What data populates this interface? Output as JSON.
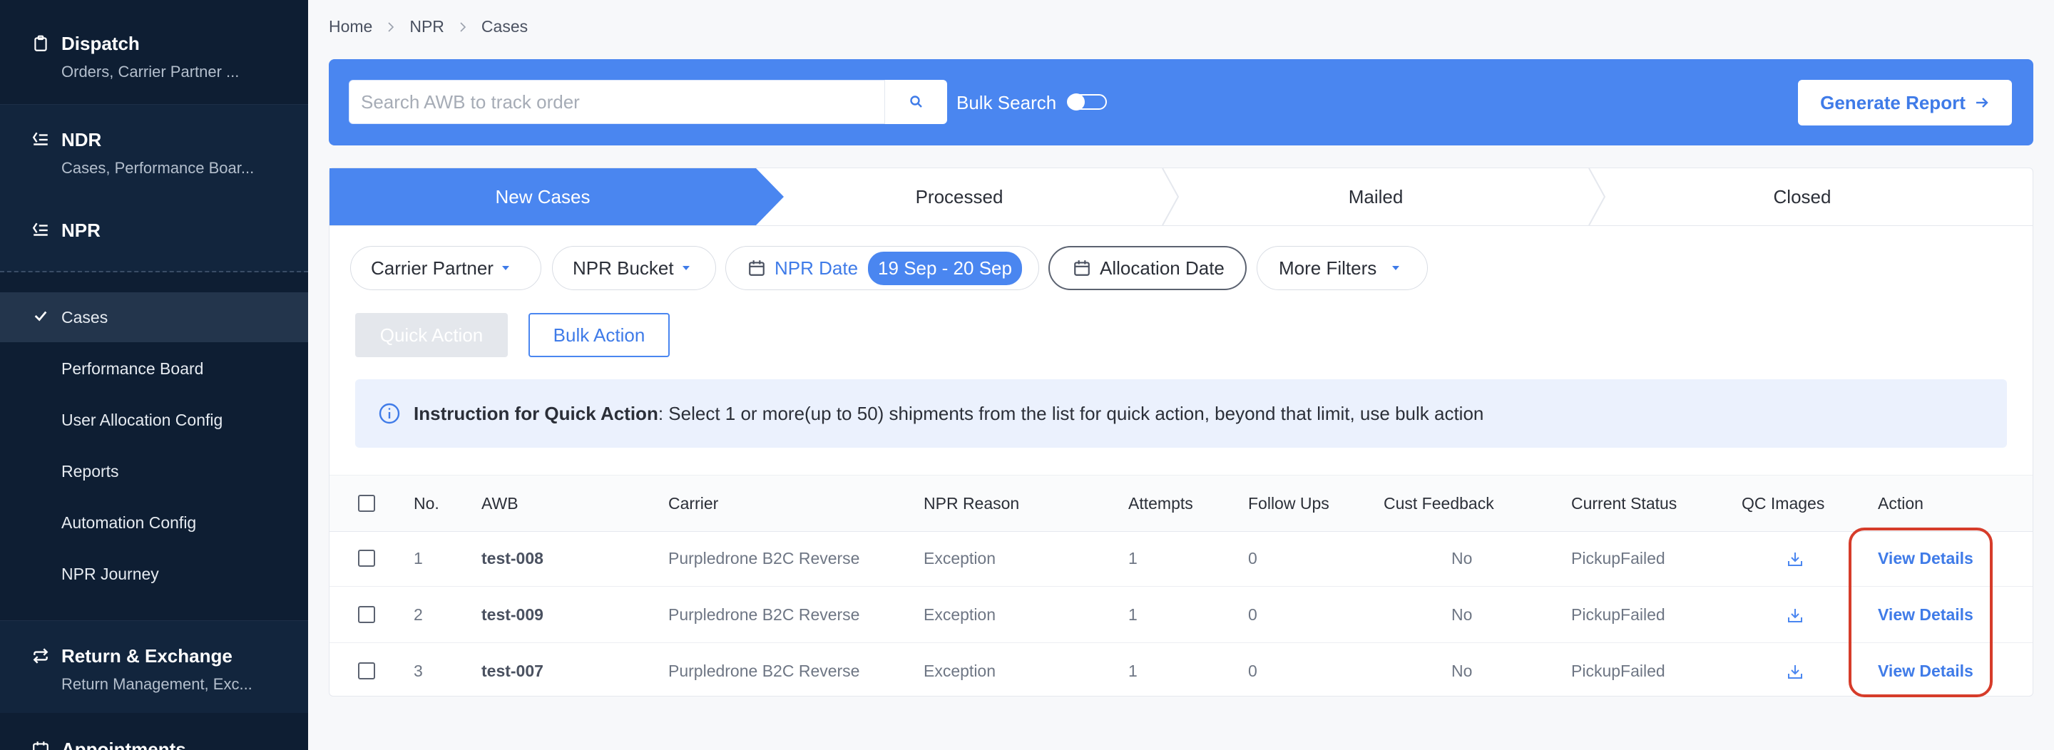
{
  "sidebar": {
    "groups": [
      {
        "title": "Dispatch",
        "desc": "Orders, Carrier Partner ..."
      },
      {
        "title": "NDR",
        "desc": "Cases, Performance Boar..."
      },
      {
        "title": "NPR",
        "desc": ""
      },
      {
        "title": "Return & Exchange",
        "desc": "Return Management, Exc..."
      },
      {
        "title": "Appointments",
        "desc": ""
      }
    ],
    "npr_items": [
      {
        "label": "Cases",
        "active": true
      },
      {
        "label": "Performance Board",
        "active": false
      },
      {
        "label": "User Allocation Config",
        "active": false
      },
      {
        "label": "Reports",
        "active": false
      },
      {
        "label": "Automation Config",
        "active": false
      },
      {
        "label": "NPR Journey",
        "active": false
      }
    ],
    "icons": {
      "dispatch": "clipboard-icon",
      "ndr": "list-arrow-icon",
      "npr": "list-arrow-icon",
      "return": "exchange-arrows-icon",
      "active_item": "check-icon"
    }
  },
  "breadcrumb": [
    "Home",
    "NPR",
    "Cases"
  ],
  "banner": {
    "search_placeholder": "Search AWB to track order",
    "bulk_search_label": "Bulk Search",
    "bulk_search_on": false,
    "generate_report_label": "Generate Report"
  },
  "steps": [
    {
      "label": "New Cases",
      "active": true
    },
    {
      "label": "Processed",
      "active": false
    },
    {
      "label": "Mailed",
      "active": false
    },
    {
      "label": "Closed",
      "active": false
    }
  ],
  "filters": {
    "carrier_partner": "Carrier Partner",
    "npr_bucket": "NPR Bucket",
    "npr_date": "NPR Date",
    "npr_date_range": "19 Sep - 20 Sep",
    "allocation_date": "Allocation Date",
    "more_filters": "More Filters"
  },
  "actions": {
    "quick": "Quick Action",
    "bulk": "Bulk Action"
  },
  "instruction": {
    "bold": "Instruction for Quick Action",
    "text": ": Select 1 or more(up to 50) shipments from the list for quick action, beyond that limit, use bulk action"
  },
  "table": {
    "headers": [
      "No.",
      "AWB",
      "Carrier",
      "NPR Reason",
      "Attempts",
      "Follow Ups",
      "Cust Feedback",
      "Current Status",
      "QC Images",
      "Action"
    ],
    "rows": [
      {
        "no": "1",
        "awb": "test-008",
        "carrier": "Purpledrone B2C Reverse",
        "reason": "Exception",
        "attempts": "1",
        "followups": "0",
        "feedback": "No",
        "status": "PickupFailed",
        "action": "View Details"
      },
      {
        "no": "2",
        "awb": "test-009",
        "carrier": "Purpledrone B2C Reverse",
        "reason": "Exception",
        "attempts": "1",
        "followups": "0",
        "feedback": "No",
        "status": "PickupFailed",
        "action": "View Details"
      },
      {
        "no": "3",
        "awb": "test-007",
        "carrier": "Purpledrone B2C Reverse",
        "reason": "Exception",
        "attempts": "1",
        "followups": "0",
        "feedback": "No",
        "status": "PickupFailed",
        "action": "View Details"
      }
    ]
  },
  "colors": {
    "accent": "#4a86f0",
    "sidebar": "#0e1e33",
    "highlight": "#d63c2a"
  }
}
